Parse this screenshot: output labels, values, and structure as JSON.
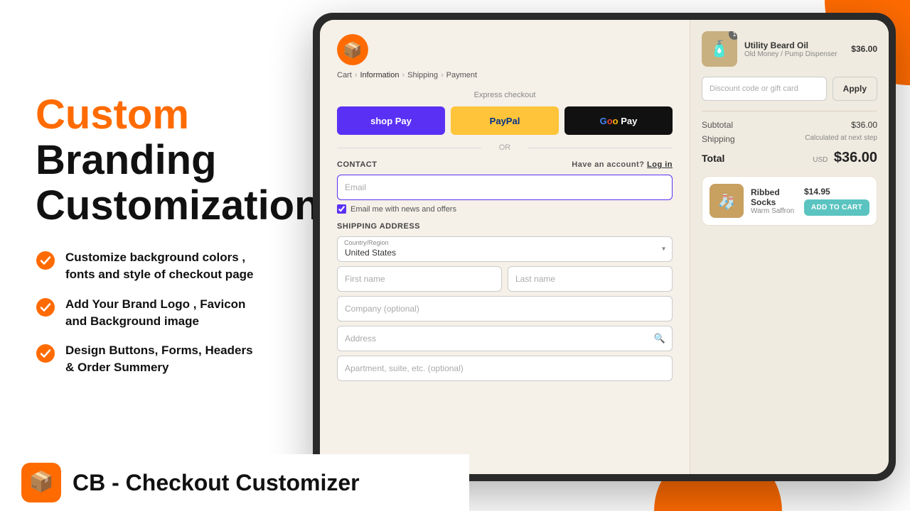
{
  "decorations": {
    "top_right_shape": "orange quarter circle",
    "bottom_right_shape": "orange semicircle"
  },
  "left_panel": {
    "headline_orange": "Custom",
    "headline_black": "Branding\nCustomization",
    "features": [
      {
        "id": "feature-1",
        "text": "Customize background colors , fonts\nand style of checkout page"
      },
      {
        "id": "feature-2",
        "text": "Add Your Brand Logo , Favicon\nand Background image"
      },
      {
        "id": "feature-3",
        "text": "Design Buttons, Forms, Headers\n& Order Summery"
      }
    ]
  },
  "bottom_bar": {
    "app_name": "CB - Checkout Customizer"
  },
  "tablet": {
    "breadcrumb": {
      "cart": "Cart",
      "information": "Information",
      "shipping": "Shipping",
      "payment": "Payment",
      "active": "Information"
    },
    "express_checkout": {
      "label": "Express checkout",
      "shoppay_label": "shop Pay",
      "paypal_label": "PayPal",
      "gpay_label": "G Pay",
      "or_label": "OR"
    },
    "contact": {
      "section_label": "CONTACT",
      "have_account": "Have an account?",
      "login_text": "Log in",
      "email_placeholder": "Email",
      "checkbox_label": "Email me with news and offers"
    },
    "shipping_address": {
      "section_label": "SHIPPING ADDRESS",
      "country_label": "Country/Region",
      "country_value": "United States",
      "first_name_placeholder": "First name",
      "last_name_placeholder": "Last name",
      "company_placeholder": "Company (optional)",
      "address_placeholder": "Address",
      "apartment_placeholder": "Apartment, suite, etc. (optional)"
    },
    "order_summary": {
      "product_name": "Utility Beard Oil",
      "product_variant": "Old Money / Pump Dispenser",
      "product_price": "$36.00",
      "product_quantity": "1",
      "discount_placeholder": "Discount code or gift card",
      "apply_button": "Apply",
      "subtotal_label": "Subtotal",
      "subtotal_value": "$36.00",
      "shipping_label": "Shipping",
      "shipping_value": "Calculated at next step",
      "total_label": "Total",
      "total_currency": "USD",
      "total_value": "$36.00"
    },
    "upsell": {
      "name": "Ribbed Socks",
      "variant": "Warm Saffron",
      "price": "$14.95",
      "button_label": "ADD TO CART"
    }
  }
}
